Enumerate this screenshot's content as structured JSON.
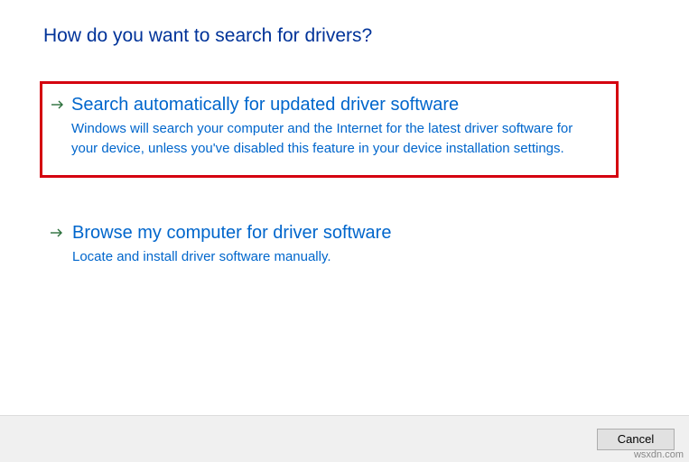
{
  "heading": "How do you want to search for drivers?",
  "options": [
    {
      "title": "Search automatically for updated driver software",
      "description": "Windows will search your computer and the Internet for the latest driver software for your device, unless you've disabled this feature in your device installation settings."
    },
    {
      "title": "Browse my computer for driver software",
      "description": "Locate and install driver software manually."
    }
  ],
  "buttons": {
    "cancel": "Cancel"
  },
  "watermark": "wsxdn.com"
}
